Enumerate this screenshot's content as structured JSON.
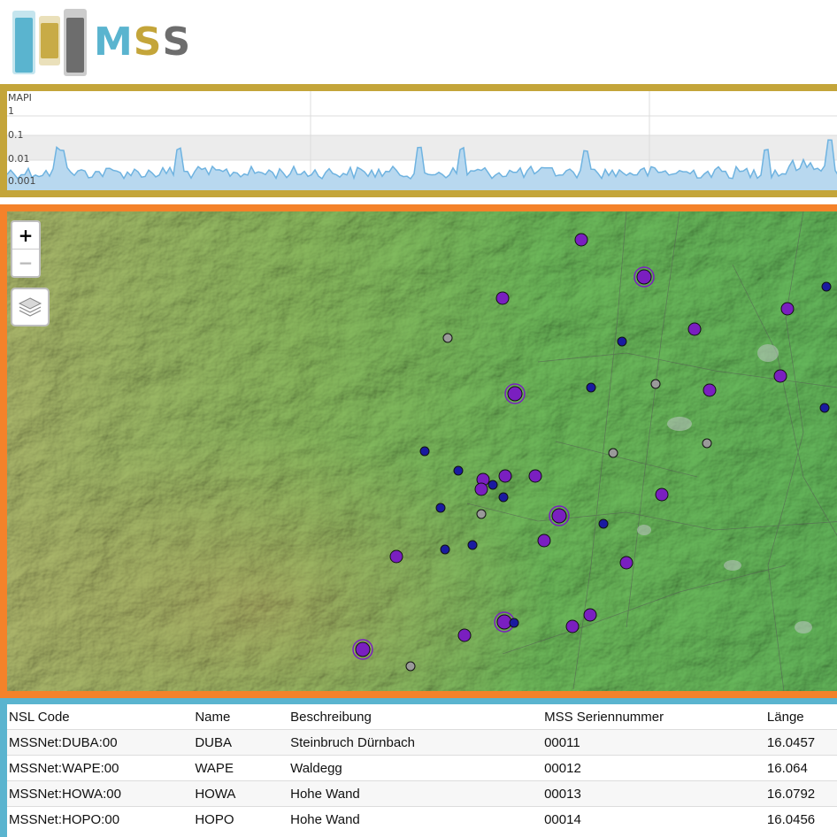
{
  "logo": {
    "text_m": "M",
    "text_s1": "S",
    "text_s2": "S",
    "colors": {
      "blue": "#5ab4cf",
      "gold": "#c4a53a",
      "gray": "#6d6d6d"
    }
  },
  "chart": {
    "ylabel": "MAPI",
    "ticks": [
      "1",
      "0.1",
      "0.01",
      "0.001"
    ],
    "border_color": "#c4a53a",
    "fill_color": "#b8d8ef",
    "line_color": "#6fb3e0"
  },
  "map": {
    "zoom_in": "+",
    "zoom_out": "−",
    "layers_icon": "layers-icon",
    "border_color": "#f4822a",
    "marker_colors": {
      "large": "#7a1fc0",
      "small": "#1a1aa0",
      "inactive": "#9a9a9a"
    }
  },
  "table": {
    "headers": [
      "NSL Code",
      "Name",
      "Beschreibung",
      "MSS Seriennummer",
      "Länge"
    ],
    "rows": [
      [
        "MSSNet:DUBA:00",
        "DUBA",
        "Steinbruch Dürnbach",
        "00011",
        "16.0457"
      ],
      [
        "MSSNet:WAPE:00",
        "WAPE",
        "Waldegg",
        "00012",
        "16.064"
      ],
      [
        "MSSNet:HOWA:00",
        "HOWA",
        "Hohe Wand",
        "00013",
        "16.0792"
      ],
      [
        "MSSNet:HOPO:00",
        "HOPO",
        "Hohe Wand",
        "00014",
        "16.0456"
      ]
    ]
  }
}
